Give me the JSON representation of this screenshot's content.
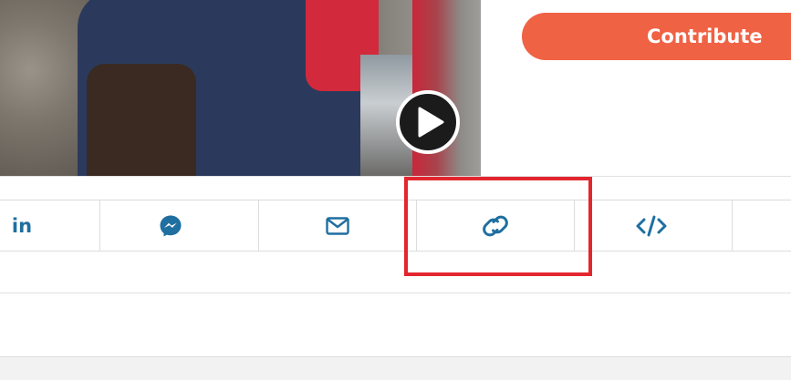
{
  "media": {
    "play_icon": "play-icon"
  },
  "header": {
    "contribute_label": "Contribute"
  },
  "share": {
    "items": [
      {
        "name": "linkedin",
        "label": "in",
        "icon": "linkedin-icon"
      },
      {
        "name": "messenger",
        "icon": "messenger-icon"
      },
      {
        "name": "email",
        "icon": "mail-icon"
      },
      {
        "name": "copy-link",
        "icon": "link-icon"
      },
      {
        "name": "embed",
        "icon": "code-icon"
      }
    ]
  },
  "colors": {
    "accent": "#f06244",
    "icon": "#1f6fa0",
    "highlight": "#e3262e"
  }
}
